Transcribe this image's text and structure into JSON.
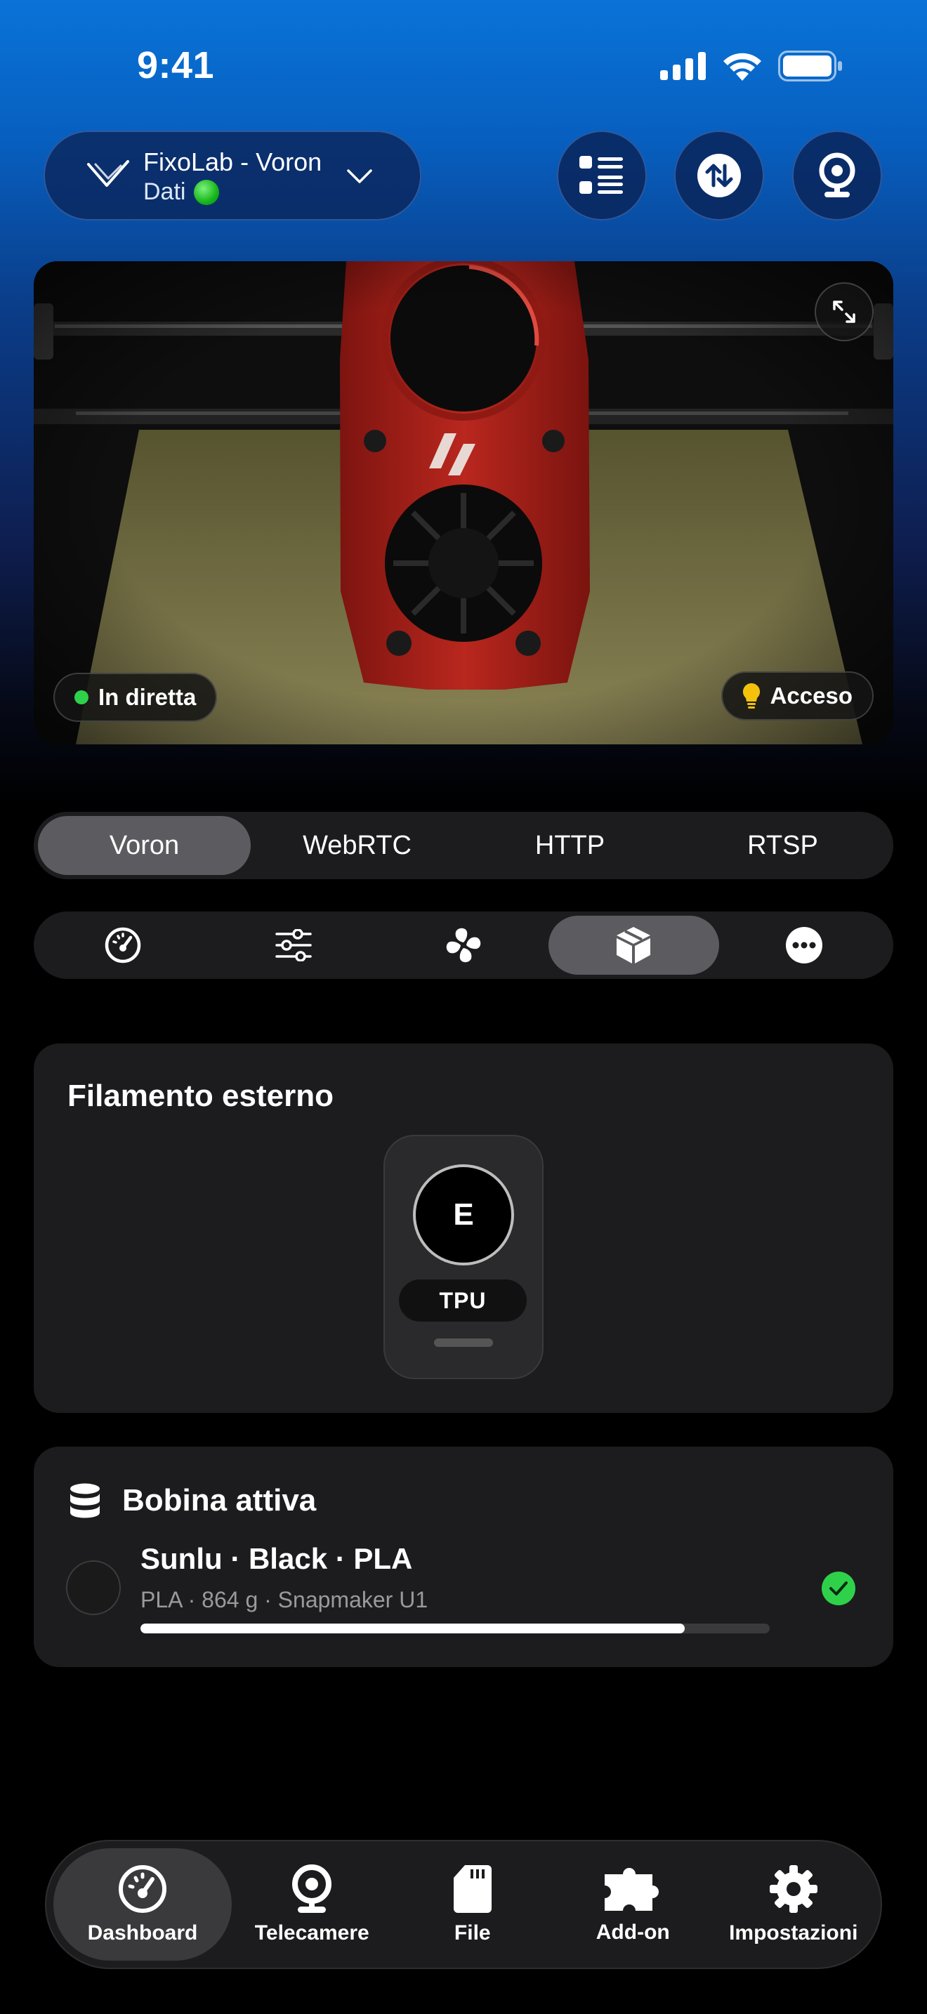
{
  "status_bar": {
    "time": "9:41"
  },
  "header": {
    "printer_name": "FixoLab - Voron",
    "printer_status": "Dati"
  },
  "camera": {
    "live_label": "In diretta",
    "light_label": "Acceso"
  },
  "stream_tabs": {
    "items": [
      "Voron",
      "WebRTC",
      "HTTP",
      "RTSP"
    ],
    "selected": "Voron"
  },
  "control_tabs": {
    "icons": [
      "speedometer-icon",
      "sliders-icon",
      "fan-icon",
      "box-icon",
      "more-icon"
    ],
    "selected": "box-icon"
  },
  "external_filament": {
    "title": "Filamento esterno",
    "slot_letter": "E",
    "material": "TPU"
  },
  "active_spool": {
    "title": "Bobina attiva",
    "name": "Sunlu · Black · PLA",
    "details": "PLA · 864 g · Snapmaker U1",
    "remaining_fraction": 0.865
  },
  "tab_bar": {
    "items": [
      "Dashboard",
      "Telecamere",
      "File",
      "Add-on",
      "Impostazioni"
    ],
    "selected": "Dashboard"
  },
  "colors": {
    "accent_green": "#2fd14a",
    "card_bg": "#1c1c1e",
    "header_blue": "#0a73d8"
  }
}
